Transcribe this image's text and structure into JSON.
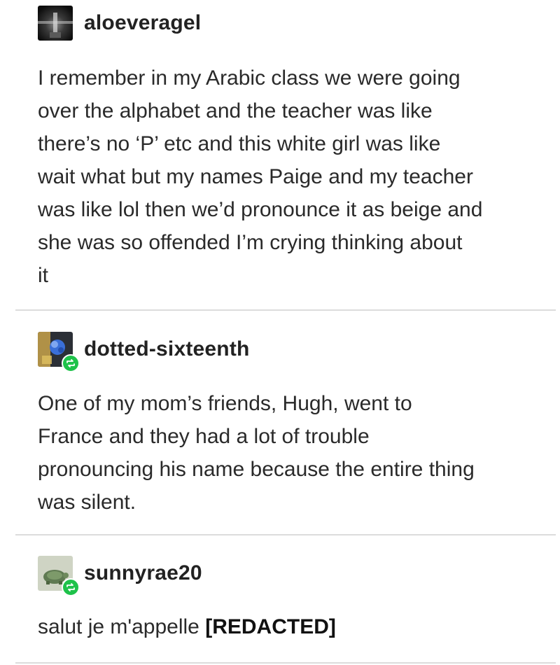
{
  "posts": [
    {
      "username": "aloeveragel",
      "avatar_icon": "dark-figure-avatar-icon",
      "body": "I remember in my Arabic class we were going\nover the alphabet and the teacher was like\nthere’s no ‘P’ etc and this white girl was like\nwait what but my names Paige and my teacher\nwas like lol then we’d pronounce it as beige and\nshe was so offended I’m crying thinking about\nit"
    },
    {
      "username": "dotted-sixteenth",
      "avatar_icon": "blue-flower-avatar-icon",
      "reblog_icon": "reblog-icon",
      "body": "One of my mom’s friends, Hugh, went to\nFrance and they had a lot of trouble\npronouncing his name because the entire thing\nwas silent."
    },
    {
      "username": "sunnyrae20",
      "avatar_icon": "turtle-avatar-icon",
      "reblog_icon": "reblog-icon",
      "body_prefix": "salut je m'appelle ",
      "body_redacted": "[REDACTED]"
    }
  ],
  "colors": {
    "reblog_badge": "#1ec24a",
    "divider": "#dcdcdc"
  }
}
